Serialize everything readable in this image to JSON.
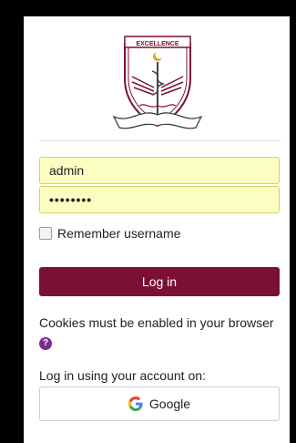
{
  "logo": {
    "text": "EXCELLENCE"
  },
  "login": {
    "username_value": "admin",
    "password_value": "••••••••",
    "remember_label": "Remember username",
    "login_button": "Log in"
  },
  "cookies": {
    "message": "Cookies must be enabled in your browser"
  },
  "sso": {
    "heading": "Log in using your account on:",
    "google_label": "Google"
  },
  "colors": {
    "primary": "#7b1035",
    "field_bg": "#fafec0",
    "help_icon": "#7b2d8f"
  }
}
